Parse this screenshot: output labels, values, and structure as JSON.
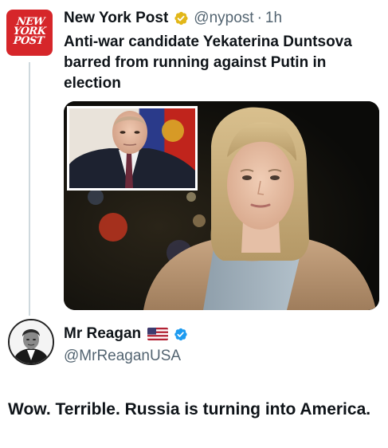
{
  "tweet": {
    "author_name": "New York Post",
    "author_handle": "@nypost",
    "separator": "·",
    "time": "1h",
    "avatar_logo_lines": [
      "NEW",
      "YORK",
      "POST"
    ],
    "verified_badge_color": "#e2b719",
    "text": "Anti-war candidate Yekaterina Duntsova barred from running against Putin in election",
    "media": {
      "main_subject": "woman-in-beige-coat-portrait",
      "inset_subject": "man-in-suit-portrait"
    }
  },
  "reply": {
    "author_name": "Mr Reagan",
    "author_handle": "@MrReaganUSA",
    "flag_icon": "us-flag-icon",
    "verified_badge_color": "#1d9bf0",
    "text": "Wow. Terrible. Russia is turning into America."
  },
  "colors": {
    "brand_red": "#d6262a",
    "thread_line": "#cfd9de",
    "secondary_text": "#536471"
  }
}
